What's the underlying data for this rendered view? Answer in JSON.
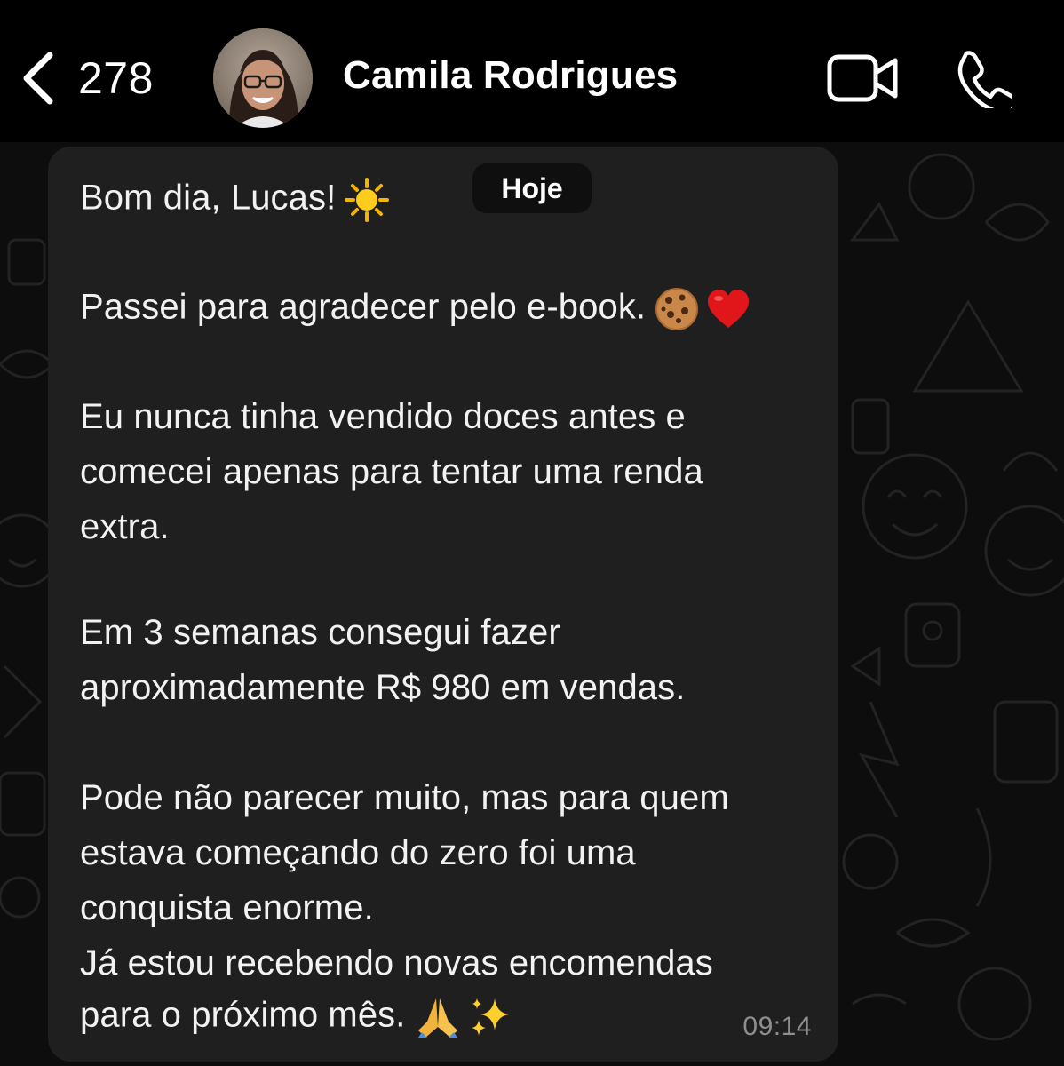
{
  "header": {
    "back_count": "278",
    "contact_name": "Camila Rodrigues",
    "icons": {
      "back": "chevron-left-icon",
      "video": "video-camera-icon",
      "call": "phone-icon"
    }
  },
  "date_pill": "Hoje",
  "message": {
    "lines": [
      "Bom dia, Lucas!",
      "Passei para agradecer pelo e-book.",
      "Eu nunca tinha vendido doces antes e",
      "comecei apenas para tentar uma renda",
      "extra.",
      "Em 3 semanas consegui fazer",
      "aproximadamente R$ 980 em vendas.",
      "Pode não parecer muito, mas para quem",
      "estava começando do zero foi uma",
      "conquista enorme.",
      "Já estou recebendo novas encomendas",
      "para o próximo mês."
    ],
    "emojis": {
      "greeting": "sun-emoji",
      "thanks": [
        "cookie-emoji",
        "red-heart-emoji"
      ],
      "closing": [
        "folded-hands-emoji",
        "sparkles-emoji"
      ]
    },
    "time": "09:14"
  },
  "colors": {
    "background": "#000000",
    "bubble": "#1f1f1f",
    "text": "#f2f2f2",
    "timestamp": "#8e8e8e"
  }
}
